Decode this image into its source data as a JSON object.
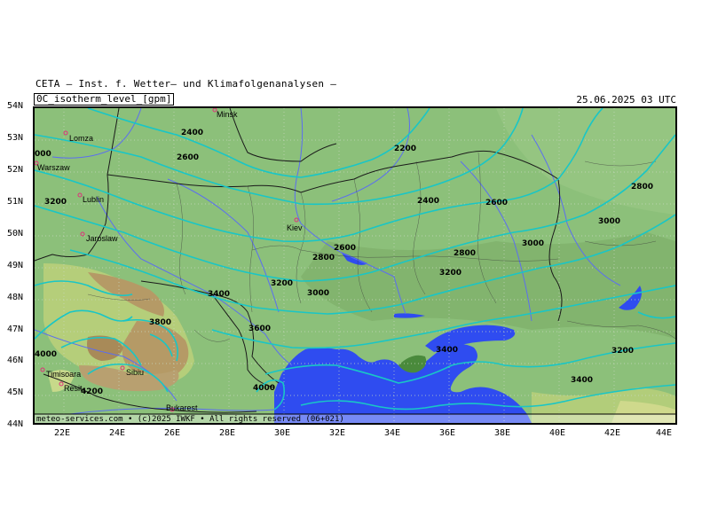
{
  "header": {
    "title": "CETA — Inst. f. Wetter— und Klimafolgenanalysen —",
    "parameter": "0C_isotherm_level_[gpm]",
    "datetime": "25.06.2025 03 UTC"
  },
  "axes": {
    "lat_labels": [
      "54N",
      "53N",
      "52N",
      "51N",
      "50N",
      "49N",
      "48N",
      "47N",
      "46N",
      "45N",
      "44N"
    ],
    "lon_labels": [
      "22E",
      "24E",
      "26E",
      "28E",
      "30E",
      "32E",
      "34E",
      "36E",
      "38E",
      "40E",
      "42E",
      "44E"
    ]
  },
  "contour_labels": [
    "2400",
    "2600",
    "2200",
    "2400",
    "2600",
    "2800",
    "3000",
    "2600",
    "2800",
    "2800",
    "3000",
    "3200",
    "3200",
    "3000",
    "3400",
    "3800",
    "3600",
    "3400",
    "3200",
    "3400",
    "4000",
    "4000",
    "4200",
    "3200",
    "000"
  ],
  "cities": [
    "Minsk",
    "Lomza",
    "Warszaw",
    "Lublin",
    "Jaroslaw",
    "Kiev",
    "Timisoara",
    "Resit",
    "Sibiu",
    "Bukarest"
  ],
  "footer": "meteo-services.com • (c)2025 IWKF • All rights reserved (06+021)",
  "colors": {
    "land": "#8cc07a",
    "sea": "#2f4cf0",
    "isotherm": "#19c6c6",
    "border": "#1a1a1a",
    "river": "#5b6ef0",
    "mountain": "#b99a6a",
    "city_marker": "#e0307a"
  }
}
